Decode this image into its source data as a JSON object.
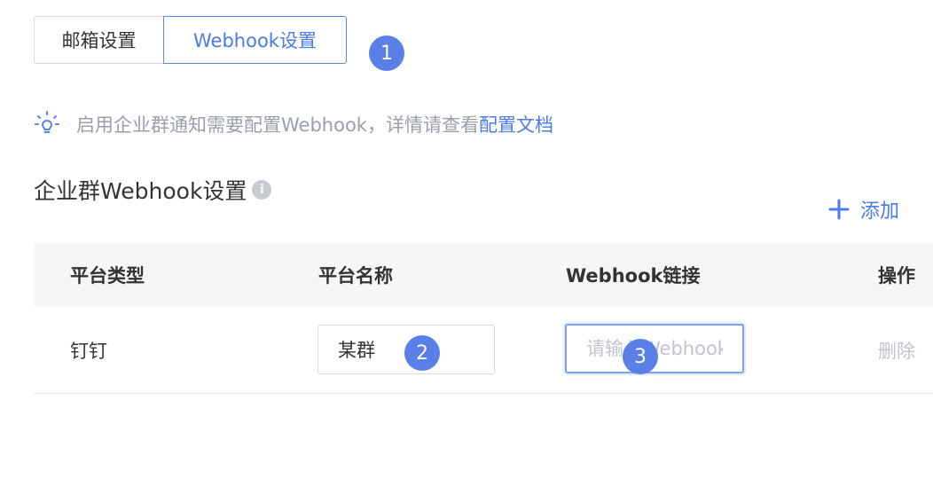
{
  "tabs": [
    {
      "label": "邮箱设置"
    },
    {
      "label": "Webhook设置"
    }
  ],
  "annotations": [
    "1",
    "2",
    "3"
  ],
  "hint": {
    "text": "启用企业群通知需要配置Webhook，详情请查看",
    "link": "配置文档",
    "icon": "lightbulb-icon"
  },
  "section": {
    "title": "企业群Webhook设置",
    "info_icon": "i"
  },
  "add_button": {
    "label": "添加",
    "icon": "plus-icon"
  },
  "table": {
    "columns": [
      "平台类型",
      "平台名称",
      "Webhook链接",
      "操作"
    ],
    "rows": [
      {
        "platform_type": "钉钉",
        "platform_name": "某群",
        "webhook_placeholder": "请输入Webhook链接",
        "webhook_value": "",
        "action": "删除"
      }
    ]
  },
  "colors": {
    "accent": "#4a7be8",
    "badge": "#5a7fe6",
    "muted": "#9aa0a8",
    "header_bg": "#f5f6f8"
  }
}
